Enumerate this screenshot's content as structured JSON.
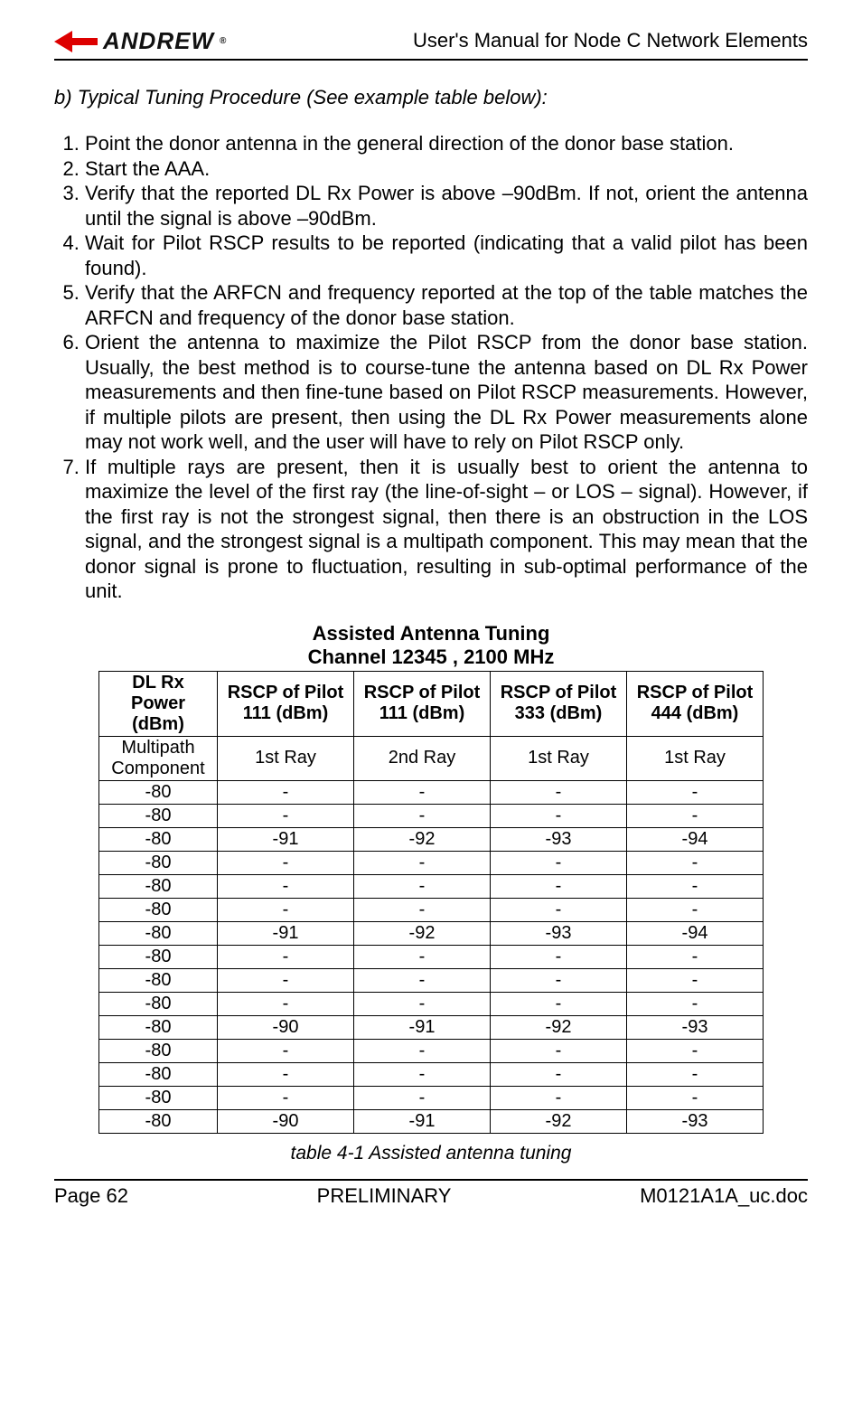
{
  "header": {
    "logo_text": "ANDREW",
    "logo_reg": "®",
    "doc_title": "User's Manual for Node C Network Elements"
  },
  "section_b": "b)  Typical Tuning Procedure (See example table below):",
  "steps": [
    "Point the donor antenna in the general direction of the donor base station.",
    "Start the AAA.",
    "Verify that the reported DL Rx Power is above –90dBm.  If not, orient the antenna until the signal is above –90dBm.",
    "Wait for Pilot RSCP results to be reported (indicating that a valid pilot has been found).",
    "Verify that the ARFCN and frequency reported at the top of the table matches the ARFCN and frequency of the donor base station.",
    "Orient the antenna to maximize the Pilot RSCP from the donor base station. Usually, the best method is to course-tune the antenna based on DL Rx Power measurements and then fine-tune based on Pilot RSCP measurements. However, if multiple pilots are present, then using the DL Rx Power measurements alone may not work well, and the user will have to rely on Pilot RSCP only.",
    "If multiple rays are present, then it is usually best to orient the antenna to maximize the level of the first ray (the line-of-sight – or LOS – signal). However, if the first ray is not the strongest signal, then there is an obstruction in the LOS signal, and the strongest signal is a multipath component. This may mean that the donor signal is prone to fluctuation, resulting in sub-optimal performance of the unit."
  ],
  "table": {
    "title": "Assisted Antenna Tuning",
    "subtitle": "Channel 12345 , 2100 MHz",
    "headers": [
      "DL Rx Power (dBm)",
      "RSCP of Pilot 111 (dBm)",
      "RSCP of Pilot 111 (dBm)",
      "RSCP of Pilot 333 (dBm)",
      "RSCP of Pilot 444 (dBm)"
    ],
    "subheaders": [
      "Multipath Component",
      "1st Ray",
      "2nd Ray",
      "1st Ray",
      "1st Ray"
    ],
    "rows": [
      [
        "-80",
        "-",
        "-",
        "-",
        "-"
      ],
      [
        "-80",
        "-",
        "-",
        "-",
        "-"
      ],
      [
        "-80",
        "-91",
        "-92",
        "-93",
        "-94"
      ],
      [
        "-80",
        "-",
        "-",
        "-",
        "-"
      ],
      [
        "-80",
        "-",
        "-",
        "-",
        "-"
      ],
      [
        "-80",
        "-",
        "-",
        "-",
        "-"
      ],
      [
        "-80",
        "-91",
        "-92",
        "-93",
        "-94"
      ],
      [
        "-80",
        "-",
        "-",
        "-",
        "-"
      ],
      [
        "-80",
        "-",
        "-",
        "-",
        "-"
      ],
      [
        "-80",
        "-",
        "-",
        "-",
        "-"
      ],
      [
        "-80",
        "-90",
        "-91",
        "-92",
        "-93"
      ],
      [
        "-80",
        "-",
        "-",
        "-",
        "-"
      ],
      [
        "-80",
        "-",
        "-",
        "-",
        "-"
      ],
      [
        "-80",
        "-",
        "-",
        "-",
        "-"
      ],
      [
        "-80",
        "-90",
        "-91",
        "-92",
        "-93"
      ]
    ],
    "caption": "table 4-1 Assisted antenna tuning"
  },
  "footer": {
    "left": "Page 62",
    "center": "PRELIMINARY",
    "right": "M0121A1A_uc.doc"
  }
}
